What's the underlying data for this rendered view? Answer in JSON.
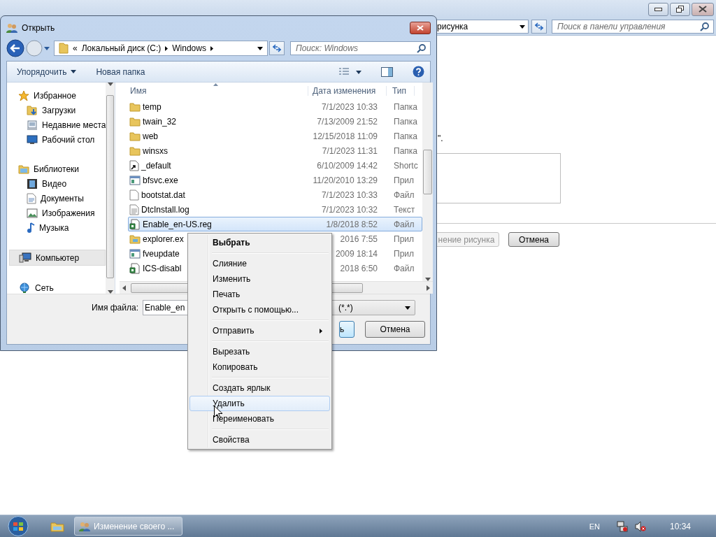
{
  "background_window": {
    "address": "рисунка",
    "search_placeholder": "Поиск в панели управления",
    "note": "\".",
    "buttons": [
      {
        "label": "нение рисунка",
        "disabled": true
      },
      {
        "label": "Отмена",
        "disabled": false
      }
    ]
  },
  "dialog": {
    "title": "Открыть",
    "breadcrumb": [
      "«",
      "Локальный диск (C:)",
      "Windows"
    ],
    "search_placeholder": "Поиск: Windows",
    "toolbar": [
      "Упорядочить",
      "Новая папка"
    ],
    "nav": [
      {
        "label": "Избранное",
        "kind": "favorites",
        "selected": false,
        "children": [
          {
            "label": "Загрузки",
            "kind": "downloads",
            "selected": false
          },
          {
            "label": "Недавние места",
            "kind": "recent",
            "selected": false
          },
          {
            "label": "Рабочий стол",
            "kind": "desktop",
            "selected": false
          }
        ]
      },
      {
        "label": "Библиотеки",
        "kind": "libraries",
        "selected": false,
        "children": [
          {
            "label": "Видео",
            "kind": "video",
            "selected": false
          },
          {
            "label": "Документы",
            "kind": "documents",
            "selected": false
          },
          {
            "label": "Изображения",
            "kind": "pictures",
            "selected": false
          },
          {
            "label": "Музыка",
            "kind": "music",
            "selected": false
          }
        ]
      },
      {
        "label": "Компьютер",
        "kind": "computer",
        "selected": true
      },
      {
        "label": "Сеть",
        "kind": "network",
        "selected": false
      }
    ],
    "columns": [
      "Имя",
      "Дата изменения",
      "Тип"
    ],
    "files": [
      {
        "name": "temp",
        "date": "7/1/2023 10:33",
        "type": "Папка",
        "kind": "folder",
        "selected": false
      },
      {
        "name": "twain_32",
        "date": "7/13/2009 21:52",
        "type": "Папка",
        "kind": "folder",
        "selected": false
      },
      {
        "name": "web",
        "date": "12/15/2018 11:09",
        "type": "Папка",
        "kind": "folder",
        "selected": false
      },
      {
        "name": "winsxs",
        "date": "7/1/2023 11:31",
        "type": "Папка",
        "kind": "folder",
        "selected": false
      },
      {
        "name": "_default",
        "date": "6/10/2009 14:42",
        "type": "Shortc",
        "kind": "shortcut",
        "selected": false
      },
      {
        "name": "bfsvc.exe",
        "date": "11/20/2010 13:29",
        "type": "Прил",
        "kind": "exe",
        "selected": false
      },
      {
        "name": "bootstat.dat",
        "date": "7/1/2023 10:33",
        "type": "Файл",
        "kind": "file",
        "selected": false
      },
      {
        "name": "DtcInstall.log",
        "date": "7/1/2023 10:32",
        "type": "Текст",
        "kind": "text",
        "selected": false
      },
      {
        "name": "Enable_en-US.reg",
        "date": "1/8/2018 8:52",
        "type": "Файл",
        "kind": "reg",
        "selected": true
      },
      {
        "name": "explorer.ex",
        "date": "2016 7:55",
        "type": "Прил",
        "kind": "app",
        "selected": false
      },
      {
        "name": "fveupdate",
        "date": "2009 18:14",
        "type": "Прил",
        "kind": "exe",
        "selected": false
      },
      {
        "name": "ICS-disabl",
        "date": "2018 6:50",
        "type": "Файл",
        "kind": "reg",
        "selected": false
      }
    ],
    "file_name_label": "Имя файла:",
    "file_name": "Enable_en",
    "file_type": "(*.*)",
    "buttons": [
      {
        "label": "ь",
        "kind": "open"
      },
      {
        "label": "Отмена",
        "kind": "cancel"
      }
    ]
  },
  "context_menu": [
    {
      "kind": "item",
      "label": "Выбрать",
      "default": true,
      "submenu": false,
      "selected": false
    },
    {
      "kind": "separator"
    },
    {
      "kind": "item",
      "label": "Слияние",
      "default": false,
      "submenu": false,
      "selected": false
    },
    {
      "kind": "item",
      "label": "Изменить",
      "default": false,
      "submenu": false,
      "selected": false
    },
    {
      "kind": "item",
      "label": "Печать",
      "default": false,
      "submenu": false,
      "selected": false
    },
    {
      "kind": "item",
      "label": "Открыть с помощью...",
      "default": false,
      "submenu": false,
      "selected": false
    },
    {
      "kind": "separator"
    },
    {
      "kind": "item",
      "label": "Отправить",
      "default": false,
      "submenu": true,
      "selected": false
    },
    {
      "kind": "separator"
    },
    {
      "kind": "item",
      "label": "Вырезать",
      "default": false,
      "submenu": false,
      "selected": false
    },
    {
      "kind": "item",
      "label": "Копировать",
      "default": false,
      "submenu": false,
      "selected": false
    },
    {
      "kind": "separator"
    },
    {
      "kind": "item",
      "label": "Создать ярлык",
      "default": false,
      "submenu": false,
      "selected": false
    },
    {
      "kind": "item",
      "label": "Удалить",
      "default": false,
      "submenu": false,
      "selected": true
    },
    {
      "kind": "item",
      "label": "Переименовать",
      "default": false,
      "submenu": false,
      "selected": false
    },
    {
      "kind": "separator"
    },
    {
      "kind": "item",
      "label": "Свойства",
      "default": false,
      "submenu": false,
      "selected": false
    }
  ],
  "taskbar": {
    "task": "Изменение своего ...",
    "language": "EN",
    "clock": "10:34"
  }
}
